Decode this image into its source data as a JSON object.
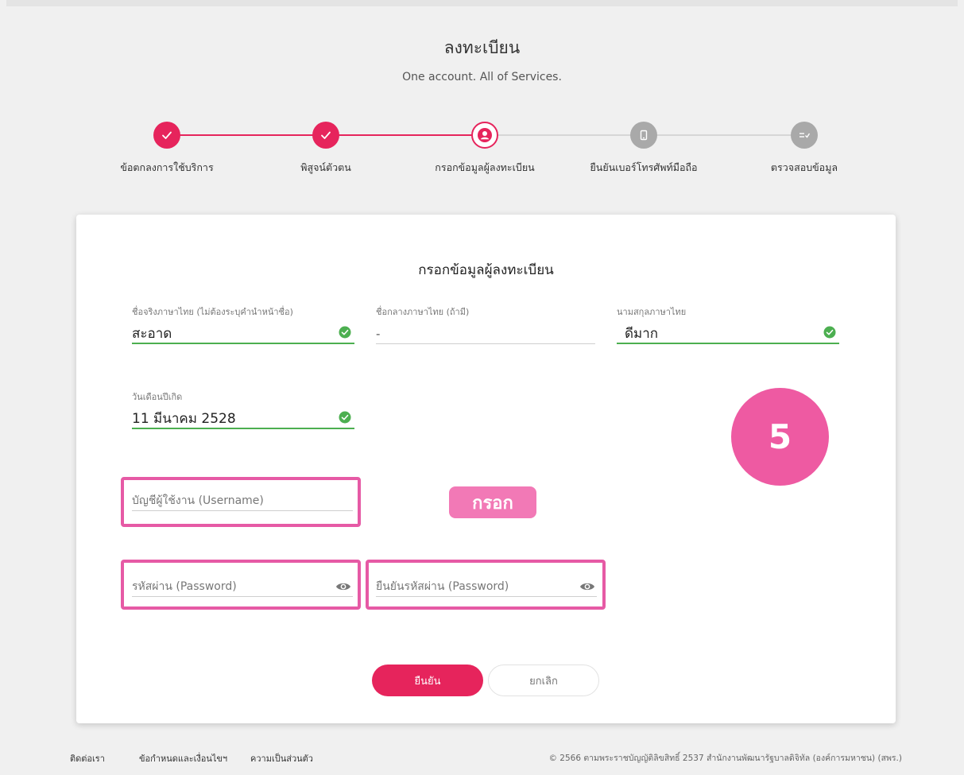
{
  "header": {
    "title": "ลงทะเบียน",
    "subtitle": "One account. All of Services."
  },
  "steps": [
    {
      "label": "ข้อตกลงการใช้บริการ",
      "status": "done",
      "icon": "check-icon"
    },
    {
      "label": "พิสูจน์ตัวตน",
      "status": "done",
      "icon": "check-icon"
    },
    {
      "label": "กรอกข้อมูลผู้ลงทะเบียน",
      "status": "current",
      "icon": "person-icon"
    },
    {
      "label": "ยืนยันเบอร์โทรศัพท์มือถือ",
      "status": "todo",
      "icon": "phone-icon"
    },
    {
      "label": "ตรวจสอบข้อมูล",
      "status": "todo",
      "icon": "list-check-icon"
    }
  ],
  "form": {
    "title": "กรอกข้อมูลผู้ลงทะเบียน",
    "first_name": {
      "label": "ชื่อจริงภาษาไทย (ไม่ต้องระบุคำนำหน้าชื่อ)",
      "value": "สะอาด"
    },
    "middle_name": {
      "label": "ชื่อกลางภาษาไทย (ถ้ามี)",
      "value": "-"
    },
    "last_name": {
      "label": "นามสกุลภาษาไทย",
      "value": "ดีมาก"
    },
    "birth_date": {
      "label": "วันเดือนปีเกิด",
      "value": "11 มีนาคม 2528"
    },
    "username": {
      "placeholder": "บัญชีผู้ใช้งาน (Username)"
    },
    "password": {
      "placeholder": "รหัสผ่าน (Password)"
    },
    "confirm_password": {
      "placeholder": "ยืนยันรหัสผ่าน (Password)"
    }
  },
  "annotation": {
    "step_number": "5",
    "fill_tag": "กรอก"
  },
  "buttons": {
    "confirm": "ยืนยัน",
    "cancel": "ยกเลิก"
  },
  "footer": {
    "links": [
      "ติดต่อเรา",
      "ข้อกำหนดและเงื่อนไขฯ",
      "ความเป็นส่วนตัว"
    ],
    "copyright": "© 2566 ตามพระราชบัญญัติลิขสิทธิ์ 2537 สำนักงานพัฒนารัฐบาลดิจิทัล (องค์การมหาชน) (สพร.)"
  },
  "colors": {
    "primary": "#e6245c",
    "success": "#4caf50",
    "highlight": "#e65aa5",
    "inactive": "#a9a9a9"
  }
}
